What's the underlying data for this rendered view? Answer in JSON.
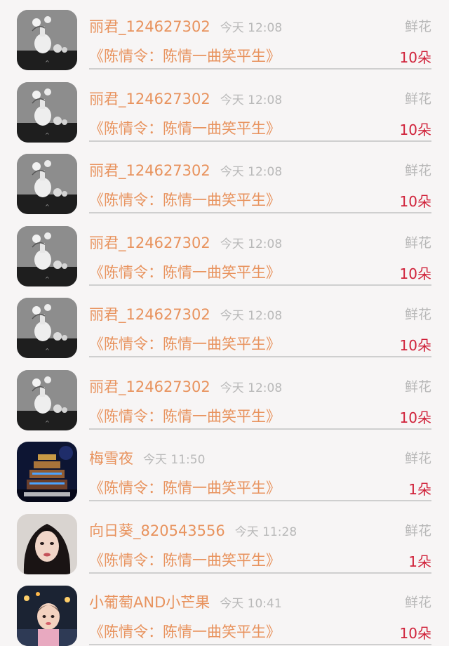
{
  "records": [
    {
      "name": "丽君_124627302",
      "time": "今天 12:08",
      "gift_type": "鲜花",
      "book_title": "《陈情令：陈情一曲笑平生》",
      "amount": "10朵",
      "avatar": "vase-photo-avatar"
    },
    {
      "name": "丽君_124627302",
      "time": "今天 12:08",
      "gift_type": "鲜花",
      "book_title": "《陈情令：陈情一曲笑平生》",
      "amount": "10朵",
      "avatar": "vase-photo-avatar"
    },
    {
      "name": "丽君_124627302",
      "time": "今天 12:08",
      "gift_type": "鲜花",
      "book_title": "《陈情令：陈情一曲笑平生》",
      "amount": "10朵",
      "avatar": "vase-photo-avatar"
    },
    {
      "name": "丽君_124627302",
      "time": "今天 12:08",
      "gift_type": "鲜花",
      "book_title": "《陈情令：陈情一曲笑平生》",
      "amount": "10朵",
      "avatar": "vase-photo-avatar"
    },
    {
      "name": "丽君_124627302",
      "time": "今天 12:08",
      "gift_type": "鲜花",
      "book_title": "《陈情令：陈情一曲笑平生》",
      "amount": "10朵",
      "avatar": "vase-photo-avatar"
    },
    {
      "name": "丽君_124627302",
      "time": "今天 12:08",
      "gift_type": "鲜花",
      "book_title": "《陈情令：陈情一曲笑平生》",
      "amount": "10朵",
      "avatar": "vase-photo-avatar"
    },
    {
      "name": "梅雪夜",
      "time": "今天 11:50",
      "gift_type": "鲜花",
      "book_title": "《陈情令：陈情一曲笑平生》",
      "amount": "1朵",
      "avatar": "night-tower-avatar"
    },
    {
      "name": "向日葵_820543556",
      "time": "今天 11:28",
      "gift_type": "鲜花",
      "book_title": "《陈情令：陈情一曲笑平生》",
      "amount": "1朵",
      "avatar": "woman-portrait-avatar"
    },
    {
      "name": "小葡萄AND小芒果",
      "time": "今天 10:41",
      "gift_type": "鲜花",
      "book_title": "《陈情令：陈情一曲笑平生》",
      "amount": "10朵",
      "avatar": "child-photo-avatar"
    }
  ],
  "colors": {
    "accent": "#e8935e",
    "amount": "#d0223a",
    "muted": "#b8b8b8",
    "background": "#f7f5f5"
  }
}
